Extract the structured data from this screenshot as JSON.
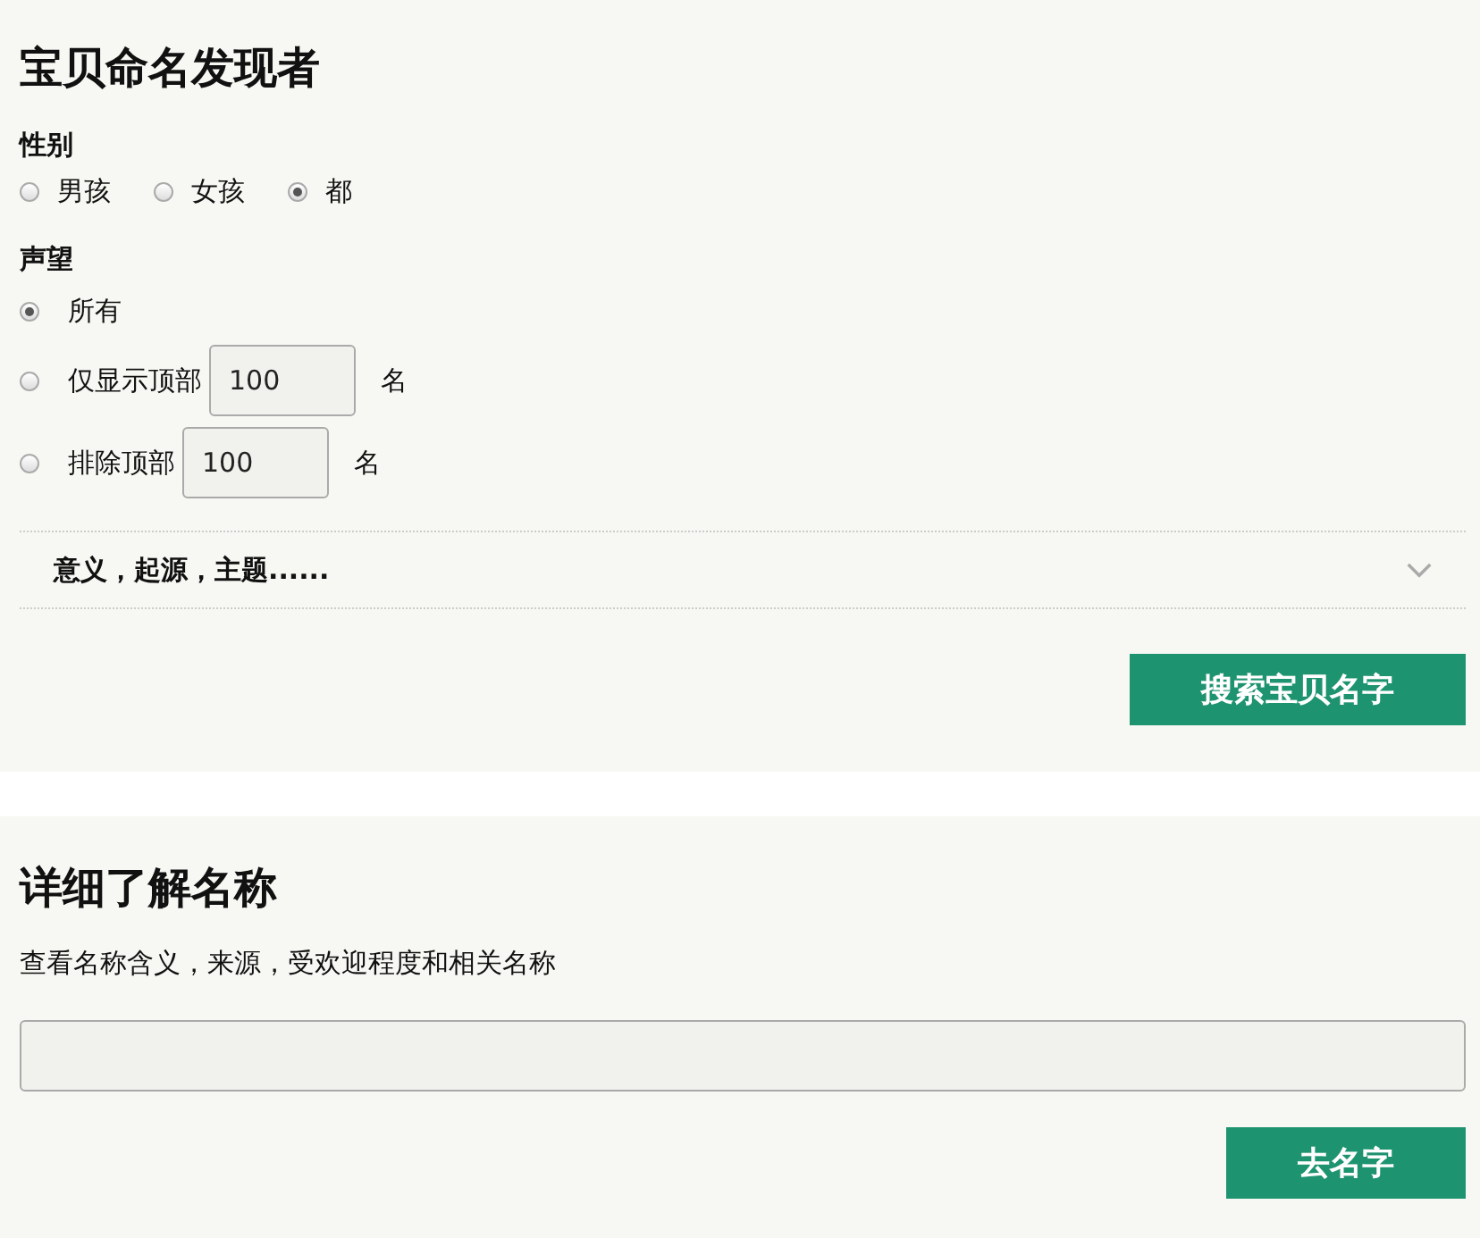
{
  "finder": {
    "title": "宝贝命名发现者",
    "gender": {
      "label": "性别",
      "options": [
        {
          "label": "男孩",
          "selected": false
        },
        {
          "label": "女孩",
          "selected": false
        },
        {
          "label": "都",
          "selected": true
        }
      ]
    },
    "popularity": {
      "label": "声望",
      "options": [
        {
          "kind": "plain",
          "label": "所有",
          "selected": true
        },
        {
          "kind": "count",
          "label": "仅显示顶部",
          "value": "100",
          "suffix": "名",
          "selected": false
        },
        {
          "kind": "count",
          "label": "排除顶部",
          "value": "100",
          "suffix": "名",
          "selected": false
        }
      ]
    },
    "expander": {
      "label": "意义，起源，主题......",
      "expanded": false
    },
    "button": "搜索宝贝名字"
  },
  "details": {
    "title": "详细了解名称",
    "description": "查看名称含义，来源，受欢迎程度和相关名称",
    "button": "去名字"
  }
}
